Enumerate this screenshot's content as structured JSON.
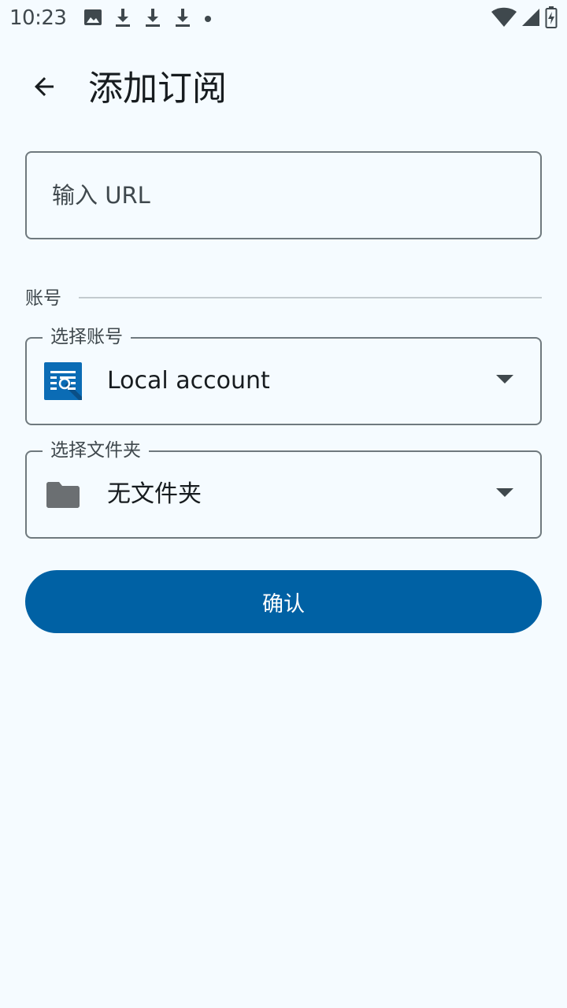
{
  "status_bar": {
    "time": "10:23",
    "notification_icons": [
      "image-icon",
      "download-icon",
      "download-icon",
      "download-icon",
      "dot-icon"
    ],
    "system_icons": [
      "wifi-icon",
      "signal-icon",
      "battery-icon"
    ]
  },
  "app_bar": {
    "title": "添加订阅",
    "back_icon": "arrow-back-icon"
  },
  "url_field": {
    "placeholder": "输入 URL",
    "value": ""
  },
  "account_section": {
    "label": "账号"
  },
  "account_dropdown": {
    "label": "选择账号",
    "value": "Local account",
    "icon": "local-account-icon"
  },
  "folder_dropdown": {
    "label": "选择文件夹",
    "value": "无文件夹",
    "icon": "folder-icon"
  },
  "confirm_button": {
    "label": "确认"
  },
  "colors": {
    "background": "#f5fbff",
    "primary": "#0061a4",
    "outline": "#6f797e",
    "text": "#171c1f"
  }
}
